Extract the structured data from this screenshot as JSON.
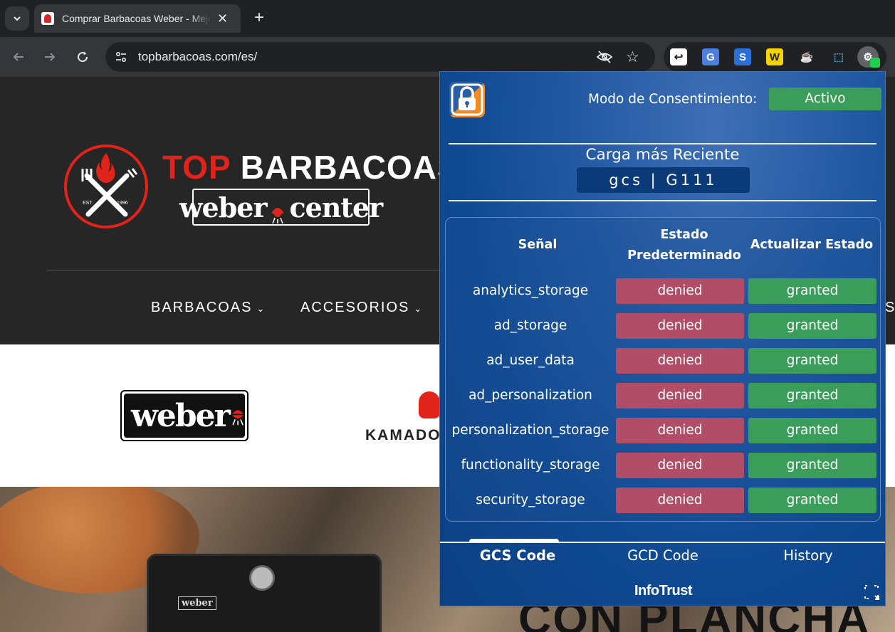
{
  "browser": {
    "tab_title": "Comprar Barbacoas Weber - Mejores",
    "url": "topbarbacoas.com/es/",
    "extensions": [
      {
        "name": "share-extension-icon",
        "glyph": "↩",
        "bg": "#ffffff",
        "fg": "#222222"
      },
      {
        "name": "translate-extension-icon",
        "glyph": "G",
        "bg": "#4a7fe0",
        "fg": "#ffffff"
      },
      {
        "name": "s-extension-icon",
        "glyph": "S",
        "bg": "#2b6fd8",
        "fg": "#ffffff"
      },
      {
        "name": "w-extension-icon",
        "glyph": "W",
        "bg": "#f5d400",
        "fg": "#222222"
      },
      {
        "name": "genie-extension-icon",
        "glyph": "☕",
        "bg": "#202124",
        "fg": "#f5b800"
      },
      {
        "name": "screenshot-extension-icon",
        "glyph": "⬚",
        "bg": "#202124",
        "fg": "#35a4d8"
      },
      {
        "name": "consent-extension-icon",
        "glyph": "⚙",
        "bg": "#5f6368",
        "fg": "#ffffff"
      }
    ]
  },
  "site": {
    "brand_red": "TOP",
    "brand_white": "BARBACOAS",
    "brand_sub_left": "weber",
    "brand_sub_right": "center",
    "logo_est": "EST.",
    "logo_year": "1996",
    "menu": [
      {
        "label": "BARBACOAS"
      },
      {
        "label": "ACCESORIOS"
      }
    ],
    "menu_cut": "S",
    "weber_logo": "weber",
    "kamado_text": "KAMADO",
    "grill_logo": "weber",
    "hero_text": "CON PLANCHA"
  },
  "popup": {
    "consent_label": "Modo de Consentimiento:",
    "consent_status": "Activo",
    "load_title": "Carga más Reciente",
    "load_value": "gcs | G111",
    "headers": {
      "signal": "Señal",
      "default": "Estado Predeterminado",
      "update": "Actualizar Estado"
    },
    "rows": [
      {
        "signal": "analytics_storage",
        "default": "denied",
        "update": "granted"
      },
      {
        "signal": "ad_storage",
        "default": "denied",
        "update": "granted"
      },
      {
        "signal": "ad_user_data",
        "default": "denied",
        "update": "granted"
      },
      {
        "signal": "ad_personalization",
        "default": "denied",
        "update": "granted"
      },
      {
        "signal": "personalization_storage",
        "default": "denied",
        "update": "granted"
      },
      {
        "signal": "functionality_storage",
        "default": "denied",
        "update": "granted"
      },
      {
        "signal": "security_storage",
        "default": "denied",
        "update": "granted"
      }
    ],
    "tabs": [
      {
        "label": "GCS Code",
        "active": true
      },
      {
        "label": "GCD Code",
        "active": false
      },
      {
        "label": "History",
        "active": false
      }
    ],
    "footer_brand": "InfoTrust",
    "colors": {
      "granted": "#3a9d5a",
      "denied": "#b24d68",
      "active": "#3a9d5a"
    }
  }
}
